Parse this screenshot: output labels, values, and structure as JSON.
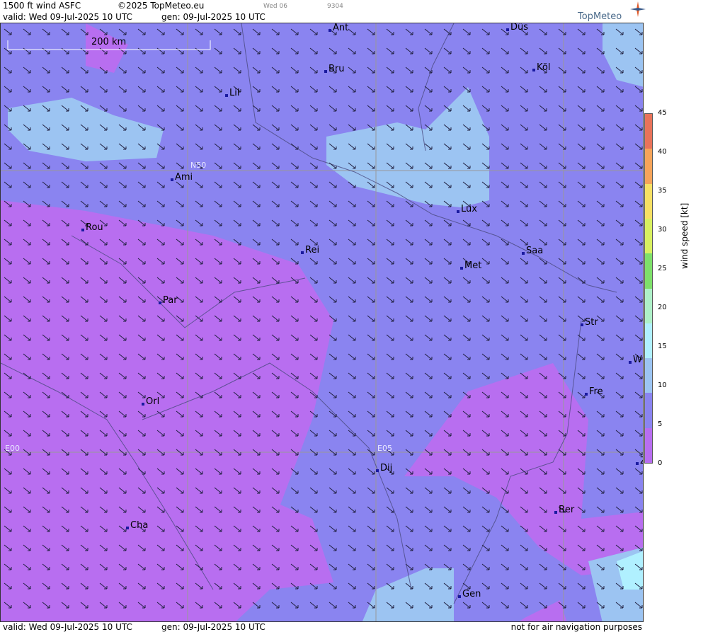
{
  "header": {
    "title": "1500 ft wind ASFC",
    "copyright": "©2025 TopMeteo.eu",
    "tab_day": "Wed 06",
    "tab_code": "9304",
    "valid": "valid:  Wed  09-Jul-2025  10 UTC",
    "gen": "gen: 09-Jul-2025 10 UTC",
    "brand": "TopMeteo"
  },
  "scale_bar": {
    "label": "200 km"
  },
  "grid_labels": {
    "n50": "N50",
    "e00": "E00",
    "e05": "E05"
  },
  "cities": [
    {
      "name": "Ant"
    },
    {
      "name": "Düs"
    },
    {
      "name": "Bru"
    },
    {
      "name": "Köl"
    },
    {
      "name": "Lil"
    },
    {
      "name": "Ami"
    },
    {
      "name": "Lux"
    },
    {
      "name": "Rou"
    },
    {
      "name": "Rei"
    },
    {
      "name": "Saa"
    },
    {
      "name": "Met"
    },
    {
      "name": "Par"
    },
    {
      "name": "Str"
    },
    {
      "name": "W"
    },
    {
      "name": "Orl"
    },
    {
      "name": "Fre"
    },
    {
      "name": "Dij"
    },
    {
      "name": "Z"
    },
    {
      "name": "Ber"
    },
    {
      "name": "Cha"
    },
    {
      "name": "Gen"
    }
  ],
  "legend": {
    "title": "wind speed [kt]",
    "ticks": [
      "45",
      "40",
      "35",
      "30",
      "25",
      "20",
      "15",
      "10",
      "5",
      "0"
    ],
    "colors": [
      "#e8735a",
      "#f6a45a",
      "#f7e064",
      "#d8f060",
      "#7ee06a",
      "#aef0c8",
      "#b0f0ff",
      "#9cc4f2",
      "#8a84f0",
      "#b86ef0"
    ]
  },
  "footer": {
    "valid": "valid:  Wed  09-Jul-2025  10 UTC",
    "gen": "gen: 09-Jul-2025 10 UTC",
    "note": "not for air navigation purposes"
  }
}
